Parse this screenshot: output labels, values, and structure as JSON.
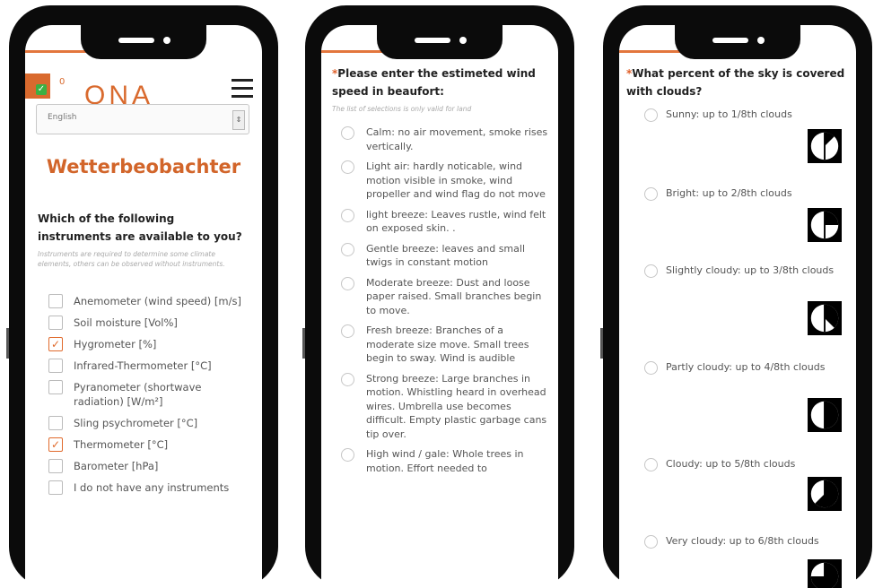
{
  "phone1": {
    "badge_count": "0",
    "logo": "ONA",
    "language": "English",
    "title": "Wetterbeobachter",
    "question": "Which of the following instruments are available to you?",
    "hint": "Instruments are required to determine some climate elements, others can be observed without instruments.",
    "instruments": [
      {
        "label": "Anemometer (wind speed) [m/s]",
        "checked": false
      },
      {
        "label": "Soil moisture [Vol%]",
        "checked": false
      },
      {
        "label": "Hygrometer [%]",
        "checked": true
      },
      {
        "label": "Infrared-Thermometer [°C]",
        "checked": false
      },
      {
        "label": "Pyranometer (shortwave radiation) [W/m²]",
        "checked": false
      },
      {
        "label": "Sling psychrometer [°C]",
        "checked": false
      },
      {
        "label": "Thermometer [°C]",
        "checked": true
      },
      {
        "label": "Barometer [hPa]",
        "checked": false
      },
      {
        "label": "I do not have any instruments",
        "checked": false
      }
    ]
  },
  "phone2": {
    "required_mark": "*",
    "question": "Please enter the estimeted wind speed in beaufort:",
    "hint": "The list of selections is only valid for land",
    "options": [
      "Calm: no air movement, smoke rises vertically.",
      "Light air: hardly noticable, wind motion visible in smoke, wind propeller and wind flag do not move",
      "light breeze: Leaves rustle, wind felt on exposed skin. .",
      "Gentle breeze: leaves and small twigs in constant motion",
      "Moderate breeze: Dust and loose paper raised. Small branches begin to move.",
      "Fresh breeze: Branches of a moderate size move. Small trees begin to sway. Wind is audible",
      "Strong breeze: Large branches in motion. Whistling heard in overhead wires. Umbrella use becomes difficult. Empty plastic garbage cans tip over.",
      "High wind / gale: Whole trees in motion. Effort needed to"
    ]
  },
  "phone3": {
    "required_mark": "*",
    "question": "What percent of the sky is covered with clouds?",
    "options": [
      {
        "label": "Sunny: up to 1/8th clouds",
        "eighths": 1
      },
      {
        "label": "Bright: up to 2/8th clouds",
        "eighths": 2
      },
      {
        "label": "Slightly cloudy: up to 3/8th clouds",
        "eighths": 3
      },
      {
        "label": "Partly cloudy: up to 4/8th clouds",
        "eighths": 4
      },
      {
        "label": "Cloudy: up to 5/8th clouds",
        "eighths": 5
      },
      {
        "label": "Very cloudy: up to 6/8th clouds",
        "eighths": 6
      }
    ]
  },
  "colors": {
    "accent": "#d2652a",
    "check": "#e06a2c",
    "frame": "#0b0b0b"
  }
}
